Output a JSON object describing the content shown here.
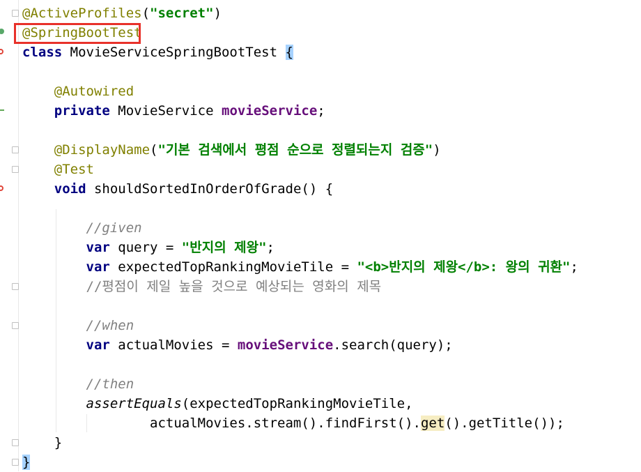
{
  "code": {
    "line1": {
      "ann": "@ActiveProfiles",
      "open": "(",
      "str": "\"secret\"",
      "close": ")"
    },
    "line2": {
      "ann": "@SpringBootTest"
    },
    "line3": {
      "kw": "class",
      "name": " MovieServiceSpringBootTest ",
      "brace": "{"
    },
    "line5": {
      "ann": "@Autowired"
    },
    "line6": {
      "kw": "private",
      "type": " MovieService ",
      "field": "movieService",
      "end": ";"
    },
    "line8": {
      "ann": "@DisplayName",
      "open": "(",
      "str": "\"기본 검색에서 평점 순으로 정렬되는지 검증\"",
      "close": ")"
    },
    "line9": {
      "ann": "@Test"
    },
    "line10": {
      "kw": "void",
      "rest": " shouldSortedInOrderOfGrade() {"
    },
    "line12": {
      "cmt": "//given"
    },
    "line13": {
      "kw": "var",
      "mid": " query = ",
      "str": "\"반지의 제왕\"",
      "end": ";"
    },
    "line14": {
      "kw": "var",
      "mid": " expectedTopRankingMovieTile = ",
      "str": "\"<b>반지의 제왕</b>: 왕의 귀환\"",
      "end": ";"
    },
    "line15": {
      "cmt": "//평점이 제일 높을 것으로 예상되는 영화의 제목"
    },
    "line17": {
      "cmt": "//when"
    },
    "line18": {
      "kw": "var",
      "mid": " actualMovies = ",
      "field": "movieService",
      "rest": ".search(query);"
    },
    "line20": {
      "cmt": "//then"
    },
    "line21": {
      "fn": "assertEquals",
      "rest": "(expectedTopRankingMovieTile,"
    },
    "line22": {
      "pre": "actualMovies.stream().findFirst().",
      "hl": "get",
      "post": "().getTitle());"
    },
    "line23": {
      "brace": "}"
    },
    "line24": {
      "brace": "}"
    }
  },
  "highlight": {
    "box_color": "#e8312a",
    "target": "@SpringBootTest"
  }
}
